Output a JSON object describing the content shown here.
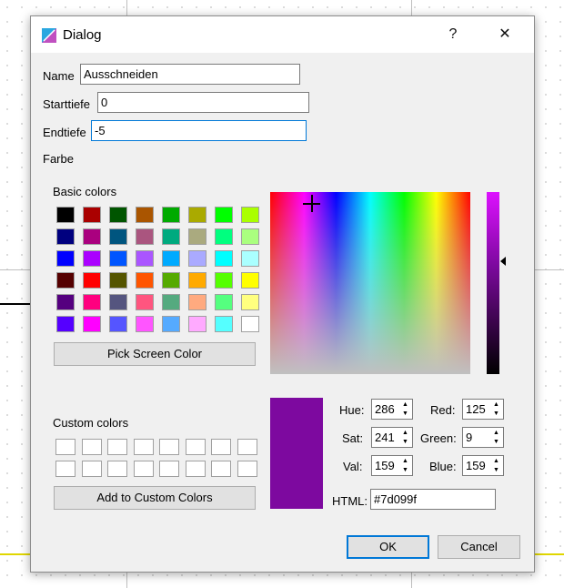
{
  "window": {
    "title": "Dialog",
    "help_glyph": "?",
    "close_glyph": "✕",
    "icon": "app-icon"
  },
  "form": {
    "name_label": "Name",
    "name_value": "Ausschneiden",
    "start_label": "Starttiefe",
    "start_value": "0",
    "end_label": "Endtiefe",
    "end_value": "-5",
    "color_label": "Farbe"
  },
  "picker": {
    "basic_label": "Basic colors",
    "basic_colors": [
      "#000000",
      "#aa0000",
      "#005500",
      "#aa5500",
      "#00aa00",
      "#aaaa00",
      "#00ff00",
      "#aaff00",
      "#00007f",
      "#aa007f",
      "#00557f",
      "#aa557f",
      "#00aa7f",
      "#aaaa7f",
      "#00ff7f",
      "#aaff7f",
      "#0000ff",
      "#aa00ff",
      "#0055ff",
      "#aa55ff",
      "#00aaff",
      "#aaaaff",
      "#00ffff",
      "#aaffff",
      "#550000",
      "#ff0000",
      "#555500",
      "#ff5500",
      "#55aa00",
      "#ffaa00",
      "#55ff00",
      "#ffff00",
      "#55007f",
      "#ff007f",
      "#55557f",
      "#ff557f",
      "#55aa7f",
      "#ffaa7f",
      "#55ff7f",
      "#ffff7f",
      "#5500ff",
      "#ff00ff",
      "#5555ff",
      "#ff55ff",
      "#55aaff",
      "#ffaaff",
      "#55ffff",
      "#ffffff"
    ],
    "pick_screen_label": "Pick Screen Color",
    "custom_label": "Custom colors",
    "add_custom_label": "Add to Custom Colors",
    "current_color": "#7d099f",
    "hue_label": "Hue:",
    "hue": "286",
    "sat_label": "Sat:",
    "sat": "241",
    "val_label": "Val:",
    "val": "159",
    "red_label": "Red:",
    "red": "125",
    "green_label": "Green:",
    "green": "9",
    "blue_label": "Blue:",
    "blue": "159",
    "html_label": "HTML:",
    "html_value": "#7d099f"
  },
  "buttons": {
    "ok_label": "OK",
    "cancel_label": "Cancel"
  }
}
